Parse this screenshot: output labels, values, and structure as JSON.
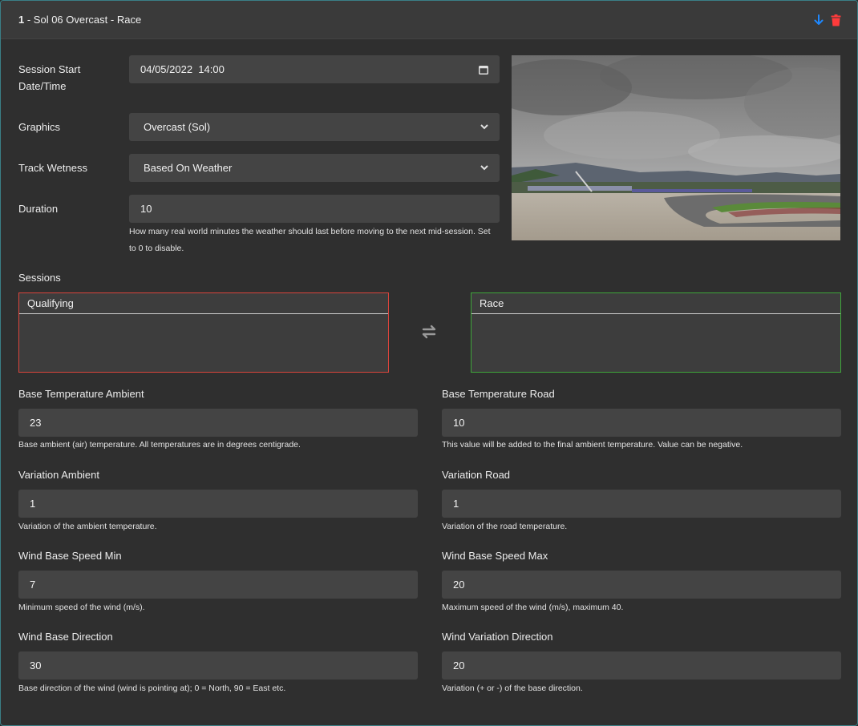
{
  "header": {
    "index": "1",
    "title": " - Sol 06 Overcast - Race"
  },
  "session_start": {
    "label_line1": "Session Start",
    "label_line2": "Date/Time",
    "value": "04/05/2022  14:00"
  },
  "graphics": {
    "label": "Graphics",
    "value": "Overcast (Sol)"
  },
  "track_wetness": {
    "label": "Track Wetness",
    "value": "Based On Weather"
  },
  "duration": {
    "label": "Duration",
    "value": "10",
    "help_line1": "How many real world minutes the weather should last before moving to the next mid-session. Set",
    "help_line2": "to 0 to disable."
  },
  "sessions": {
    "label": "Sessions",
    "left_title": "Qualifying",
    "right_title": "Race"
  },
  "fields": {
    "temp_ambient": {
      "label": "Base Temperature Ambient",
      "value": "23",
      "help": "Base ambient (air) temperature. All temperatures are in degrees centigrade."
    },
    "temp_road": {
      "label": "Base Temperature Road",
      "value": "10",
      "help": "This value will be added to the final ambient temperature. Value can be negative."
    },
    "var_ambient": {
      "label": "Variation Ambient",
      "value": "1",
      "help": "Variation of the ambient temperature."
    },
    "var_road": {
      "label": "Variation Road",
      "value": "1",
      "help": "Variation of the road temperature."
    },
    "wind_min": {
      "label": "Wind Base Speed Min",
      "value": "7",
      "help": "Minimum speed of the wind (m/s)."
    },
    "wind_max": {
      "label": "Wind Base Speed Max",
      "value": "20",
      "help": "Maximum speed of the wind (m/s), maximum 40."
    },
    "wind_dir": {
      "label": "Wind Base Direction",
      "value": "30",
      "help": "Base direction of the wind (wind is pointing at); 0 = North, 90 = East etc."
    },
    "wind_var_dir": {
      "label": "Wind Variation Direction",
      "value": "20",
      "help": "Variation (+ or -) of the base direction."
    }
  },
  "icons": {
    "move_down": "arrow-down-icon",
    "delete": "trash-icon",
    "calendar": "calendar-icon",
    "select_chevron": "chevron-down-icon",
    "swap": "swap-arrows-icon"
  },
  "colors": {
    "move_down": "#1e88ff",
    "delete": "#ff3b3b",
    "qualifying_border": "#d9443c",
    "race_border": "#3fa63a",
    "accent_border": "#3a7f86"
  }
}
